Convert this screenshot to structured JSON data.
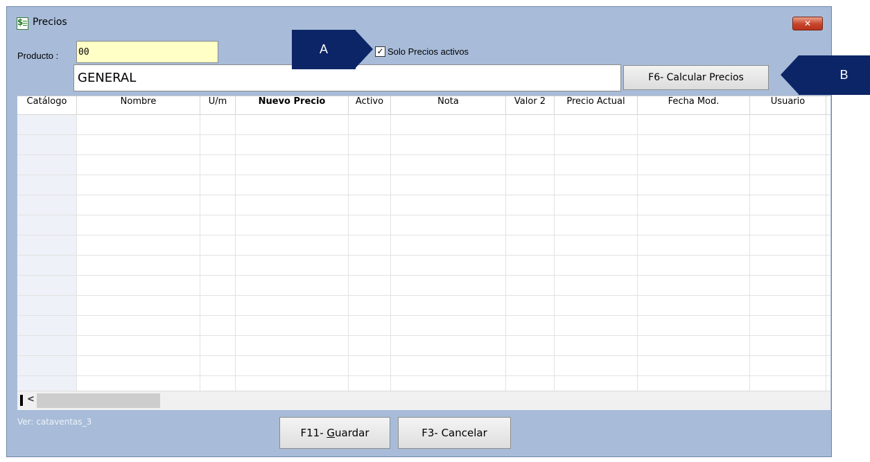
{
  "window": {
    "title": "Precios",
    "close_label": "✕"
  },
  "form": {
    "producto_label": "Producto :",
    "producto_value": "00",
    "descripcion_value": "GENERAL",
    "solo_activos_label": "Solo Precios activos",
    "solo_activos_checked": true,
    "calcular_label": "F6- Calcular Precios"
  },
  "grid": {
    "columns": [
      "Catálogo",
      "Nombre",
      "U/m",
      "Nuevo Precio",
      "Activo",
      "Nota",
      "Valor 2",
      "Precio Actual",
      "Fecha Mod.",
      "Usuario"
    ],
    "rows": []
  },
  "footer": {
    "version": "Ver: cataventas_3",
    "guardar_prefix": "F11- ",
    "guardar_hotkey": "G",
    "guardar_rest": "uardar",
    "cancelar_label": "F3- Cancelar"
  },
  "callouts": {
    "a": "A",
    "b": "B"
  },
  "colors": {
    "window_bg": "#a8bcd9",
    "callout_bg": "#0c2566",
    "product_field_bg": "#ffffc6"
  }
}
